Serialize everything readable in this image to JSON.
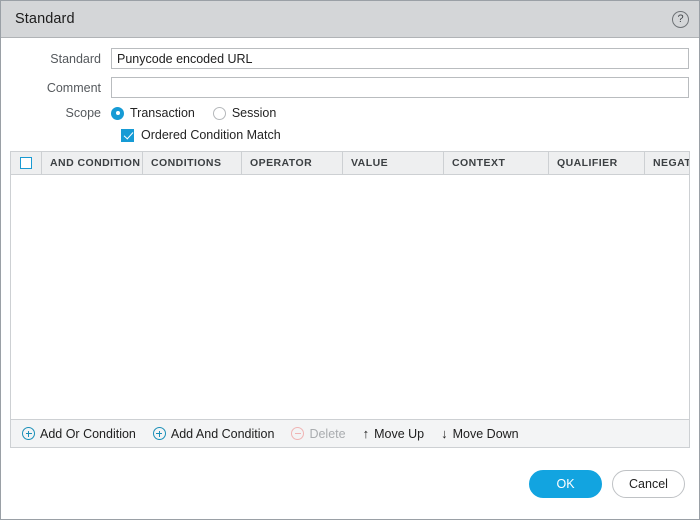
{
  "window": {
    "title": "Standard",
    "help_icon": "help-circle-icon",
    "help_glyph": "?"
  },
  "form": {
    "standard": {
      "label": "Standard",
      "value": "Punycode encoded URL",
      "placeholder": ""
    },
    "comment": {
      "label": "Comment",
      "value": "",
      "placeholder": ""
    },
    "scope": {
      "label": "Scope",
      "selected": "Transaction",
      "options": [
        {
          "label": "Transaction",
          "selected": true
        },
        {
          "label": "Session",
          "selected": false
        }
      ]
    },
    "ordered_condition_match": {
      "label": "Ordered Condition Match",
      "checked": true
    }
  },
  "table": {
    "select_all_checked": false,
    "columns": [
      "AND CONDITION",
      "CONDITIONS",
      "OPERATOR",
      "VALUE",
      "CONTEXT",
      "QUALIFIER",
      "NEGATE"
    ],
    "rows": [],
    "toolbar": [
      {
        "label": "Add Or Condition",
        "icon": "plus-circle-icon",
        "enabled": true
      },
      {
        "label": "Add And Condition",
        "icon": "plus-circle-icon",
        "enabled": true
      },
      {
        "label": "Delete",
        "icon": "minus-circle-icon",
        "enabled": false
      },
      {
        "label": "Move Up",
        "icon": "arrow-up-icon",
        "glyph": "↑",
        "enabled": true
      },
      {
        "label": "Move Down",
        "icon": "arrow-down-icon",
        "glyph": "↓",
        "enabled": true
      }
    ]
  },
  "footer": {
    "ok_label": "OK",
    "cancel_label": "Cancel"
  },
  "colors": {
    "accent": "#12a4e0",
    "checkbox": "#169bd5",
    "icon_blue": "#1a8fb8",
    "titlebar": "#d4d6d8",
    "header_bg": "#eeeff0",
    "disabled_text": "#a9acaf"
  }
}
